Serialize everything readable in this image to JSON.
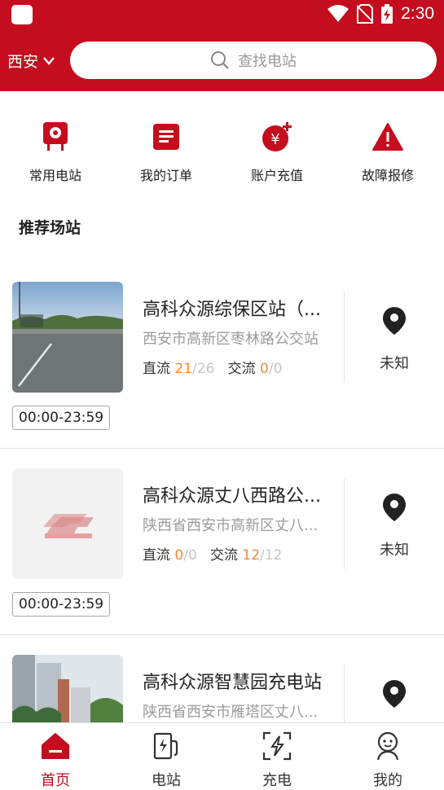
{
  "status_bar": {
    "time": "2:30",
    "icons": [
      "app-square-icon",
      "wifi-icon",
      "no-sim-icon",
      "battery-charging-icon"
    ]
  },
  "header": {
    "city": "西安",
    "search_placeholder": "查找电站"
  },
  "quick_actions": [
    {
      "label": "常用电站",
      "icon": "favorite-station-icon"
    },
    {
      "label": "我的订单",
      "icon": "order-list-icon"
    },
    {
      "label": "账户充值",
      "icon": "recharge-icon"
    },
    {
      "label": "故障报修",
      "icon": "fault-warning-icon"
    }
  ],
  "section": {
    "title": "推荐场站"
  },
  "stations": [
    {
      "name": "高科众源综保区站（...",
      "address": "西安市高新区枣林路公交站",
      "dc_label": "直流",
      "dc_available": "21",
      "dc_total": "/26",
      "ac_label": "交流",
      "ac_available": "0",
      "ac_total": "/0",
      "distance": "未知",
      "hours": "00:00-23:59",
      "image": "parking-lot-photo"
    },
    {
      "name": "高科众源丈八西路公...",
      "address": "陕西省西安市高新区丈八...",
      "dc_label": "直流",
      "dc_available": "0",
      "dc_total": "/0",
      "ac_label": "交流",
      "ac_available": "12",
      "ac_total": "/12",
      "distance": "未知",
      "hours": "00:00-23:59",
      "image": "placeholder-logo"
    },
    {
      "name": "高科众源智慧园充电站",
      "address": "陕西省西安市雁塔区丈八...",
      "distance": "",
      "image": "building-photo"
    }
  ],
  "tabbar": [
    {
      "label": "首页",
      "icon": "home-icon",
      "active": true
    },
    {
      "label": "电站",
      "icon": "charging-station-icon",
      "active": false
    },
    {
      "label": "充电",
      "icon": "charge-scan-icon",
      "active": false
    },
    {
      "label": "我的",
      "icon": "profile-icon",
      "active": false
    }
  ],
  "colors": {
    "brand_red": "#c40d1e",
    "count_orange": "#f08a3c",
    "muted_gray": "#9b9b9b"
  }
}
